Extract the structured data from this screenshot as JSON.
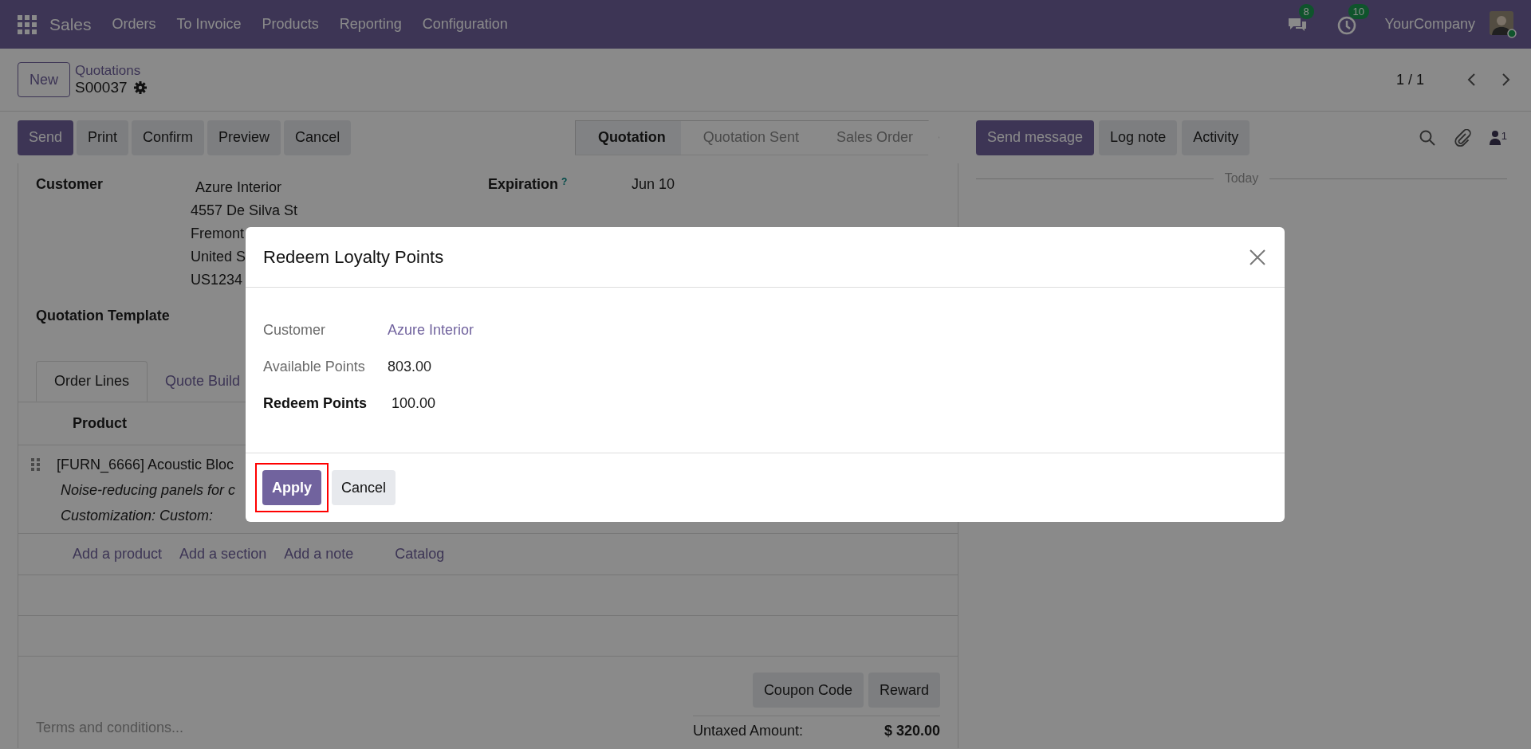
{
  "navbar": {
    "app": "Sales",
    "menu": [
      "Orders",
      "To Invoice",
      "Products",
      "Reporting",
      "Configuration"
    ],
    "messages_badge": "8",
    "activities_badge": "10",
    "company": "YourCompany"
  },
  "control_panel": {
    "new_button": "New",
    "breadcrumb": "Quotations",
    "record": "S00037",
    "pager": "1 / 1"
  },
  "action_buttons": [
    {
      "label": "Send",
      "kind": "primary"
    },
    {
      "label": "Print",
      "kind": "secondary"
    },
    {
      "label": "Confirm",
      "kind": "secondary"
    },
    {
      "label": "Preview",
      "kind": "secondary"
    },
    {
      "label": "Cancel",
      "kind": "secondary"
    }
  ],
  "status_steps": [
    {
      "label": "Quotation",
      "selected": true
    },
    {
      "label": "Quotation Sent",
      "selected": false
    },
    {
      "label": "Sales Order",
      "selected": false
    }
  ],
  "chatter": {
    "buttons": [
      {
        "label": "Send message",
        "kind": "primary"
      },
      {
        "label": "Log note",
        "kind": "secondary"
      },
      {
        "label": "Activity",
        "kind": "secondary"
      }
    ],
    "followers_count": "1",
    "date_separator": "Today"
  },
  "form": {
    "customer_label": "Customer",
    "customer_name": "Azure Interior",
    "address_lines": [
      "4557 De Silva St",
      "Fremont",
      "United S",
      "US1234"
    ],
    "expiration_label": "Expiration",
    "expiration_help": "?",
    "expiration_value": "Jun 10",
    "template_label": "Quotation Template",
    "tabs": [
      {
        "label": "Order Lines",
        "selected": true
      },
      {
        "label": "Quote Build",
        "selected": false
      }
    ],
    "product_header": "Product",
    "lines": [
      {
        "product": "[FURN_6666] Acoustic Bloc",
        "description": [
          "Noise-reducing panels for c",
          "Customization: Custom:"
        ]
      }
    ],
    "add_links": [
      "Add a product",
      "Add a section",
      "Add a note",
      "Catalog"
    ],
    "reward_buttons": [
      "Coupon Code",
      "Reward"
    ],
    "terms_placeholder": "Terms and conditions...",
    "totals": [
      {
        "label": "Untaxed Amount:",
        "value": "$ 320.00"
      }
    ]
  },
  "dialog": {
    "title": "Redeem Loyalty Points",
    "fields": [
      {
        "label": "Customer",
        "value": "Azure Interior",
        "kind": "link"
      },
      {
        "label": "Available Points",
        "value": "803.00",
        "kind": "readonly"
      },
      {
        "label": "Redeem Points",
        "value": "100.00",
        "kind": "input"
      }
    ],
    "buttons": [
      {
        "label": "Apply",
        "kind": "primary",
        "highlighted": true
      },
      {
        "label": "Cancel",
        "kind": "secondary",
        "highlighted": false
      }
    ]
  }
}
